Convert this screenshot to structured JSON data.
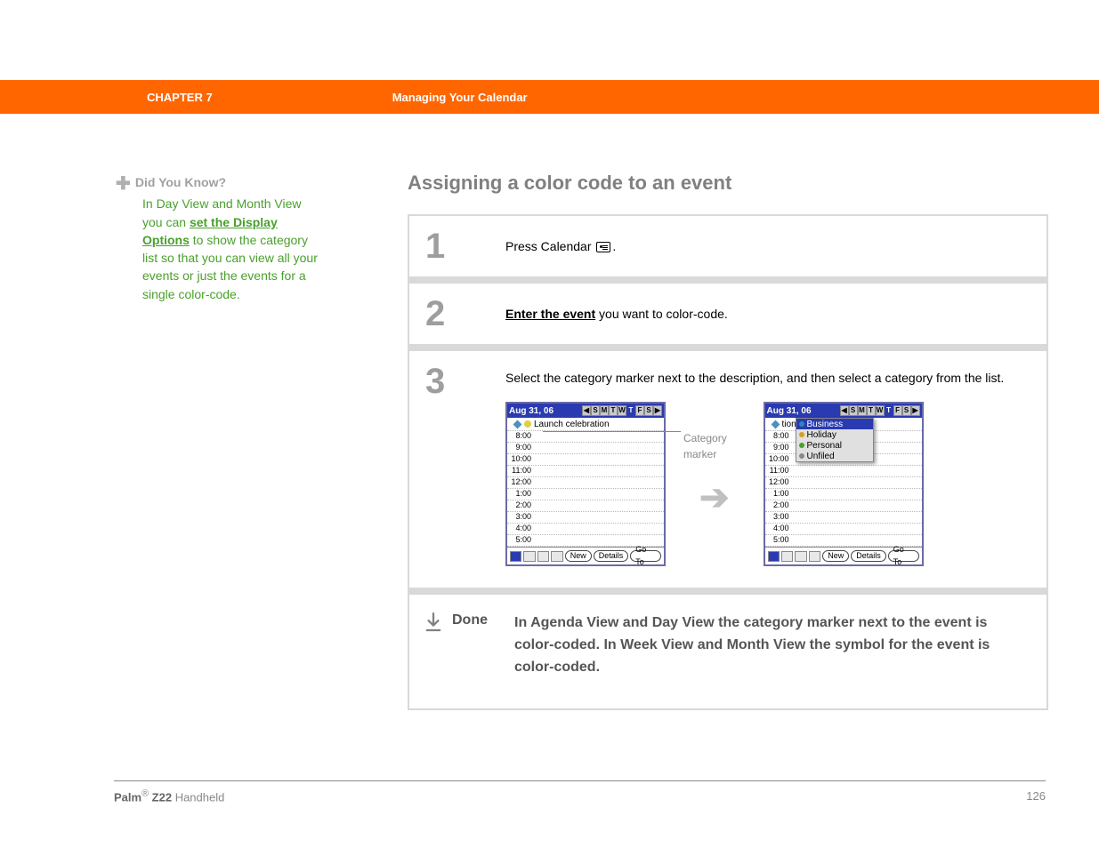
{
  "header": {
    "chapter": "CHAPTER 7",
    "title": "Managing Your Calendar"
  },
  "sidebar": {
    "dyk_title": "Did You Know?",
    "body_before": "In Day View and Month View you can ",
    "link": "set the Display Options",
    "body_after": " to show the category list so that you can view all your events or just the events for a single color-code."
  },
  "main": {
    "heading": "Assigning a color code to an event",
    "step1_num": "1",
    "step1_text_before": "Press Calendar ",
    "step1_text_after": ".",
    "step2_num": "2",
    "step2_link": "Enter the event",
    "step2_text_after": " you want to color-code.",
    "step3_num": "3",
    "step3_text": "Select the category marker next to the description, and then select a category from the list.",
    "annotation": "Category marker",
    "done_label": "Done",
    "done_text": "In Agenda View and Day View the category marker next to the event is color-coded. In Week View and Month View the symbol for the event is color-coded."
  },
  "palm": {
    "date": "Aug 31, 06",
    "days": [
      "S",
      "M",
      "T",
      "W",
      "T",
      "F",
      "S"
    ],
    "selected_day_index": 4,
    "event_title": "Launch celebration",
    "event_title_trunc": "tion",
    "times": [
      "8:00",
      "9:00",
      "10:00",
      "11:00",
      "12:00",
      "1:00",
      "2:00",
      "3:00",
      "4:00",
      "5:00"
    ],
    "categories": [
      {
        "name": "Business",
        "color": "#2a87c0",
        "selected": true
      },
      {
        "name": "Holiday",
        "color": "#d4a020"
      },
      {
        "name": "Personal",
        "color": "#4aa02c"
      },
      {
        "name": "Unfiled",
        "color": "#888888"
      }
    ],
    "buttons": {
      "new": "New",
      "details": "Details",
      "goto": "Go To"
    }
  },
  "footer": {
    "brand_bold": "Palm",
    "brand_reg": "®",
    "brand_model": " Z22",
    "brand_suffix": " Handheld",
    "page": "126"
  }
}
